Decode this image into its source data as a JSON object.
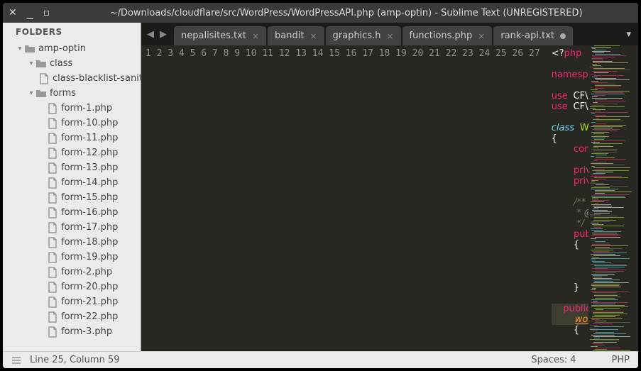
{
  "title": "~/Downloads/cloudflare/src/WordPress/WordPressAPI.php (amp-optin) - Sublime Text (UNREGISTERED)",
  "sidebar": {
    "header": "FOLDERS",
    "items": [
      {
        "d": 0,
        "t": "folder",
        "n": "amp-optin",
        "open": true
      },
      {
        "d": 1,
        "t": "folder",
        "n": "class",
        "open": true
      },
      {
        "d": 2,
        "t": "file",
        "n": "class-blacklist-sanitizer.php"
      },
      {
        "d": 1,
        "t": "folder",
        "n": "forms",
        "open": true
      },
      {
        "d": 2,
        "t": "file",
        "n": "form-1.php"
      },
      {
        "d": 2,
        "t": "file",
        "n": "form-10.php"
      },
      {
        "d": 2,
        "t": "file",
        "n": "form-11.php"
      },
      {
        "d": 2,
        "t": "file",
        "n": "form-12.php"
      },
      {
        "d": 2,
        "t": "file",
        "n": "form-13.php"
      },
      {
        "d": 2,
        "t": "file",
        "n": "form-14.php"
      },
      {
        "d": 2,
        "t": "file",
        "n": "form-15.php"
      },
      {
        "d": 2,
        "t": "file",
        "n": "form-16.php"
      },
      {
        "d": 2,
        "t": "file",
        "n": "form-17.php"
      },
      {
        "d": 2,
        "t": "file",
        "n": "form-18.php"
      },
      {
        "d": 2,
        "t": "file",
        "n": "form-19.php"
      },
      {
        "d": 2,
        "t": "file",
        "n": "form-2.php"
      },
      {
        "d": 2,
        "t": "file",
        "n": "form-20.php"
      },
      {
        "d": 2,
        "t": "file",
        "n": "form-21.php"
      },
      {
        "d": 2,
        "t": "file",
        "n": "form-22.php"
      },
      {
        "d": 2,
        "t": "file",
        "n": "form-3.php"
      }
    ]
  },
  "tabs": [
    {
      "label": "nepalisites.txt",
      "dirty": false
    },
    {
      "label": "bandit",
      "dirty": false
    },
    {
      "label": "graphics.h",
      "dirty": false
    },
    {
      "label": "functions.php",
      "dirty": false
    },
    {
      "label": "rank-api.txt",
      "dirty": true
    }
  ],
  "status": {
    "pos": "Line 25, Column 59",
    "spaces": "Spaces: 4",
    "lang": "PHP"
  },
  "code_lines": 27
}
